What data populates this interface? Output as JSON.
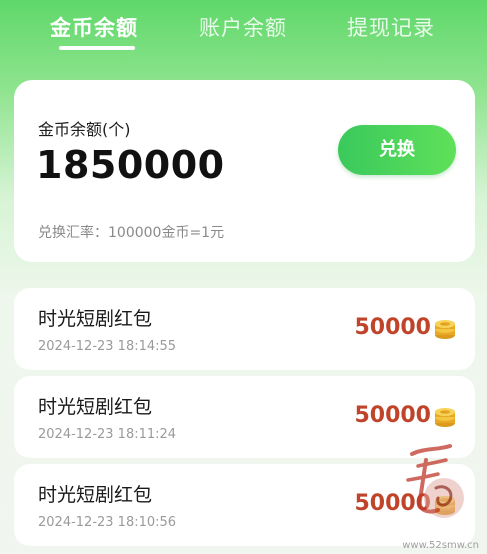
{
  "tabs": [
    {
      "label": "金币余额",
      "active": true
    },
    {
      "label": "账户余额",
      "active": false
    },
    {
      "label": "提现记录",
      "active": false
    }
  ],
  "balance": {
    "label": "金币余额(个)",
    "amount": "1850000",
    "exchange_button": "兑换",
    "rate_text": "兑换汇率：100000金币=1元"
  },
  "records": [
    {
      "title": "时光短剧红包",
      "time": "2024-12-23 18:14:55",
      "amount": "50000",
      "icon": "coin-stack-icon"
    },
    {
      "title": "时光短剧红包",
      "time": "2024-12-23 18:11:24",
      "amount": "50000",
      "icon": "coin-stack-icon"
    },
    {
      "title": "时光短剧红包",
      "time": "2024-12-23 18:10:56",
      "amount": "50000",
      "icon": "coin-stack-icon"
    }
  ],
  "watermark": {
    "site": "www.52smw.cn",
    "logo_text": "吾爱"
  },
  "colors": {
    "accent_green": "#3ac95c",
    "amount_red": "#c0442a",
    "coin_gold": "#f2b632"
  }
}
